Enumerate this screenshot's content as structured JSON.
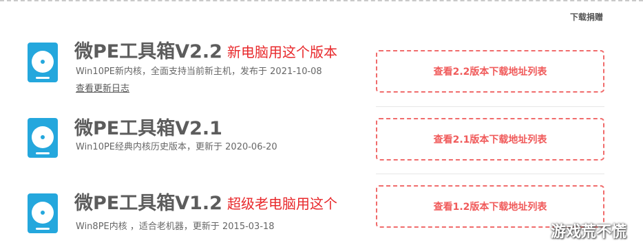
{
  "header": {
    "donate_label": "下载捐赠"
  },
  "entries": [
    {
      "title": "微PE工具箱V2.2",
      "tag": "新电脑用这个版本",
      "desc": "Win10PE新内核，全面支持当前新主机，发布于 2021-10-08",
      "changelog": "查看更新日志",
      "button": "查看2.2版本下载地址列表"
    },
    {
      "title": "微PE工具箱V2.1",
      "desc": "Win10PE经典内核历史版本，更新于 2020-06-20",
      "button": "查看2.1版本下载地址列表"
    },
    {
      "title": "微PE工具箱V1.2",
      "tag": "超级老电脑用这个",
      "desc": "Win8PE内核 ，适合老机器，更新于 2015-03-18",
      "button": "查看1.2版本下载地址列表"
    }
  ],
  "watermark": "游戏荒不慌",
  "colors": {
    "logo": "#24a7dd",
    "tag": "#e8282b",
    "button_border": "#f06b6b",
    "button_text": "#f05a5a"
  }
}
